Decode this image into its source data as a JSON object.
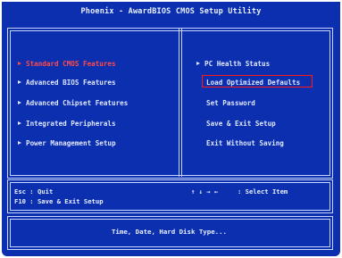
{
  "title": "Phoenix - AwardBIOS CMOS Setup Utility",
  "left_menu": [
    {
      "label": "Standard CMOS Features"
    },
    {
      "label": "Advanced BIOS Features"
    },
    {
      "label": "Advanced Chipset Features"
    },
    {
      "label": "Integrated Peripherals"
    },
    {
      "label": "Power Management Setup"
    }
  ],
  "right_menu": [
    {
      "label": "PC Health Status"
    },
    {
      "label": "Load Optimized Defaults"
    },
    {
      "label": "Set Password"
    },
    {
      "label": "Save & Exit Setup"
    },
    {
      "label": "Exit Without Saving"
    }
  ],
  "help": {
    "esc": "Esc : Quit",
    "f10": "F10 : Save & Exit Setup",
    "arrows": "↑ ↓ → ←",
    "select": ": Select Item"
  },
  "description": "Time, Date, Hard Disk Type...",
  "colors": {
    "background": "#0c2fb0",
    "text": "#dfe7ff",
    "selected": "#ff4a4a",
    "highlight_box": "#ff1a1a"
  }
}
